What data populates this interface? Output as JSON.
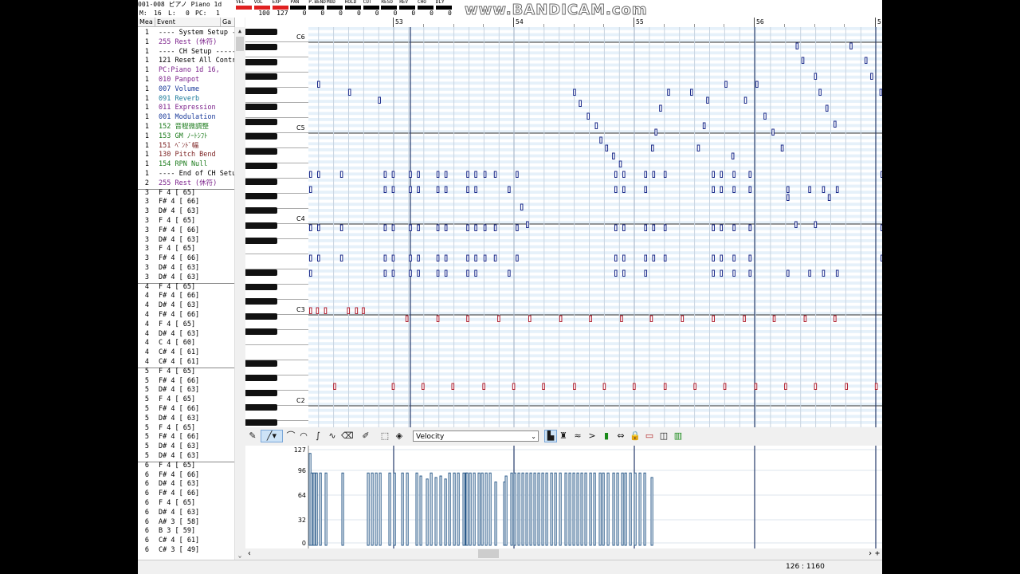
{
  "header": {
    "track_name": "001-008 ピアノ Piano 1d",
    "m_label": "M:",
    "m_value": "16",
    "l_label": "L:",
    "l_value": "0",
    "pc_label": "PC:",
    "pc_value": "1",
    "meters": [
      {
        "label": "VEL",
        "value": "",
        "color": "#e02020"
      },
      {
        "label": "VOL",
        "value": "100",
        "color": "#e02020"
      },
      {
        "label": "EXP",
        "value": "127",
        "color": "#e02020"
      },
      {
        "label": "PAN",
        "value": "0",
        "color": "#000000"
      },
      {
        "label": "P.BEND",
        "value": "0",
        "color": "#000000"
      },
      {
        "label": "MOD",
        "value": "0",
        "color": "#000000"
      },
      {
        "label": "HOLD",
        "value": "0",
        "color": "#000000"
      },
      {
        "label": "CUT",
        "value": "0",
        "color": "#000000"
      },
      {
        "label": "RESO",
        "value": "0",
        "color": "#000000"
      },
      {
        "label": "REV",
        "value": "0",
        "color": "#000000"
      },
      {
        "label": "CHO",
        "value": "0",
        "color": "#000000"
      },
      {
        "label": "DLY",
        "value": "0",
        "color": "#000000"
      }
    ],
    "watermark": "www.BANDICAM.com"
  },
  "event_list": {
    "col_meas": "Mea",
    "col_event": "Event",
    "col_gate": "Ga",
    "rows": [
      {
        "meas": "1",
        "text": "---- System Setup -",
        "color": "#000000"
      },
      {
        "meas": "1",
        "text": "255 Rest (休符)",
        "color": "#7a1f8a"
      },
      {
        "meas": "1",
        "text": "---- CH Setup -----",
        "color": "#000000"
      },
      {
        "meas": "1",
        "text": "121 Reset All Contr",
        "color": "#000000"
      },
      {
        "meas": "1",
        "text": "PC:Piano 1d      16,",
        "color": "#7a1f8a",
        "box": true
      },
      {
        "meas": "1",
        "text": "010 Panpot",
        "color": "#7a1f8a"
      },
      {
        "meas": "1",
        "text": "007 Volume",
        "color": "#1a3a9a"
      },
      {
        "meas": "1",
        "text": "091 Reverb",
        "color": "#1a7a9a"
      },
      {
        "meas": "1",
        "text": "011 Expression",
        "color": "#7a1f8a"
      },
      {
        "meas": "1",
        "text": "001 Modulation",
        "color": "#1a3a9a"
      },
      {
        "meas": "1",
        "text": "152 音程微調整",
        "color": "#1a7a1a"
      },
      {
        "meas": "1",
        "text": "153 GM ﾉｰﾄｼﾌﾄ",
        "color": "#1a7a1a"
      },
      {
        "meas": "1",
        "text": "151 ﾍﾞﾝﾄﾞ幅",
        "color": "#7a1f1f"
      },
      {
        "meas": "1",
        "text": "130 Pitch Bend",
        "color": "#7a1f1f"
      },
      {
        "meas": "1",
        "text": "154 RPN Null",
        "color": "#1a7a1a"
      },
      {
        "meas": "1",
        "text": "---- End of CH Setu",
        "color": "#000000"
      },
      {
        "meas": "2",
        "text": "255 Rest (休符)",
        "color": "#7a1f8a",
        "sep": true
      },
      {
        "meas": "3",
        "text": "F  4 [ 65]",
        "color": "#000000"
      },
      {
        "meas": "3",
        "text": "F# 4 [ 66]",
        "color": "#000000"
      },
      {
        "meas": "3",
        "text": "D# 4 [ 63]",
        "color": "#000000"
      },
      {
        "meas": "3",
        "text": "F  4 [ 65]",
        "color": "#000000"
      },
      {
        "meas": "3",
        "text": "F# 4 [ 66]",
        "color": "#000000"
      },
      {
        "meas": "3",
        "text": "D# 4 [ 63]",
        "color": "#000000"
      },
      {
        "meas": "3",
        "text": "F  4 [ 65]",
        "color": "#000000"
      },
      {
        "meas": "3",
        "text": "F# 4 [ 66]",
        "color": "#000000"
      },
      {
        "meas": "3",
        "text": "D# 4 [ 63]",
        "color": "#000000"
      },
      {
        "meas": "3",
        "text": "D# 4 [ 63]",
        "color": "#000000",
        "sep": true
      },
      {
        "meas": "4",
        "text": "F  4 [ 65]",
        "color": "#000000"
      },
      {
        "meas": "4",
        "text": "F# 4 [ 66]",
        "color": "#000000"
      },
      {
        "meas": "4",
        "text": "D# 4 [ 63]",
        "color": "#000000"
      },
      {
        "meas": "4",
        "text": "F# 4 [ 66]",
        "color": "#000000"
      },
      {
        "meas": "4",
        "text": "F  4 [ 65]",
        "color": "#000000"
      },
      {
        "meas": "4",
        "text": "D# 4 [ 63]",
        "color": "#000000"
      },
      {
        "meas": "4",
        "text": "C  4 [ 60]",
        "color": "#000000"
      },
      {
        "meas": "4",
        "text": "C# 4 [ 61]",
        "color": "#000000"
      },
      {
        "meas": "4",
        "text": "C# 4 [ 61]",
        "color": "#000000",
        "sep": true
      },
      {
        "meas": "5",
        "text": "F  4 [ 65]",
        "color": "#000000"
      },
      {
        "meas": "5",
        "text": "F# 4 [ 66]",
        "color": "#000000"
      },
      {
        "meas": "5",
        "text": "D# 4 [ 63]",
        "color": "#000000"
      },
      {
        "meas": "5",
        "text": "F  4 [ 65]",
        "color": "#000000"
      },
      {
        "meas": "5",
        "text": "F# 4 [ 66]",
        "color": "#000000"
      },
      {
        "meas": "5",
        "text": "D# 4 [ 63]",
        "color": "#000000"
      },
      {
        "meas": "5",
        "text": "F  4 [ 65]",
        "color": "#000000"
      },
      {
        "meas": "5",
        "text": "F# 4 [ 66]",
        "color": "#000000"
      },
      {
        "meas": "5",
        "text": "D# 4 [ 63]",
        "color": "#000000"
      },
      {
        "meas": "5",
        "text": "D# 4 [ 63]",
        "color": "#000000",
        "sep": true
      },
      {
        "meas": "6",
        "text": "F  4 [ 65]",
        "color": "#000000"
      },
      {
        "meas": "6",
        "text": "F# 4 [ 66]",
        "color": "#000000"
      },
      {
        "meas": "6",
        "text": "D# 4 [ 63]",
        "color": "#000000"
      },
      {
        "meas": "6",
        "text": "F# 4 [ 66]",
        "color": "#000000"
      },
      {
        "meas": "6",
        "text": "F  4 [ 65]",
        "color": "#000000"
      },
      {
        "meas": "6",
        "text": "D# 4 [ 63]",
        "color": "#000000"
      },
      {
        "meas": "6",
        "text": "A# 3 [ 58]",
        "color": "#000000"
      },
      {
        "meas": "6",
        "text": "B  3 [ 59]",
        "color": "#000000"
      },
      {
        "meas": "6",
        "text": "C# 4 [ 61]",
        "color": "#000000"
      },
      {
        "meas": "6",
        "text": "C# 3 [ 49]",
        "color": "#000000"
      }
    ]
  },
  "ruler": {
    "measures": [
      "53",
      "54",
      "55",
      "56",
      "5"
    ]
  },
  "keyboard": {
    "octave_labels": [
      "C6",
      "C5",
      "C4",
      "C3",
      "C2"
    ]
  },
  "notes": {
    "row_a": [
      0.2,
      1.6,
      5.6,
      13.2,
      14.6,
      17.6,
      19.0,
      22.4,
      23.8,
      27.6,
      29.0,
      30.6,
      32.4,
      36.2,
      53.4,
      54.8,
      58.6,
      60.0,
      62.0,
      70.4,
      71.8,
      74.0,
      76.8,
      99.8
    ],
    "row_b": [
      0.2,
      13.2,
      14.6,
      17.6,
      19.0,
      22.4,
      23.8,
      27.6,
      29.0,
      34.8,
      53.4,
      54.8,
      58.6,
      70.4,
      71.8,
      74.0,
      76.8,
      83.4,
      87.2,
      89.6,
      92.0
    ],
    "red_row_1": [
      0.2,
      1.4,
      2.8,
      6.8,
      8.2,
      9.4
    ],
    "red_row_2": [
      17.0,
      22.4,
      27.6,
      33.0,
      38.4,
      43.8,
      49.0,
      54.4,
      59.6,
      65.0,
      70.4,
      75.8,
      81.0,
      86.4,
      91.6
    ],
    "red_row_3": [
      4.4,
      14.6,
      19.8,
      25.0,
      30.4,
      35.6,
      40.8,
      46.2,
      51.4,
      56.6,
      62.0,
      67.2,
      72.4,
      77.8,
      83.0,
      88.2,
      93.6,
      98.8
    ],
    "scatter": [
      [
        1.6,
        68
      ],
      [
        7.0,
        78
      ],
      [
        12.2,
        88
      ],
      [
        46.2,
        78
      ],
      [
        47.2,
        92
      ],
      [
        48.6,
        108
      ],
      [
        50.0,
        120
      ],
      [
        50.8,
        138
      ],
      [
        51.8,
        148
      ],
      [
        53.0,
        158
      ],
      [
        54.2,
        168
      ],
      [
        59.8,
        148
      ],
      [
        60.4,
        128
      ],
      [
        61.2,
        98
      ],
      [
        62.6,
        78
      ],
      [
        66.6,
        78
      ],
      [
        67.8,
        148
      ],
      [
        68.8,
        120
      ],
      [
        69.4,
        88
      ],
      [
        72.6,
        68
      ],
      [
        73.8,
        158
      ],
      [
        76.0,
        88
      ],
      [
        78.0,
        68
      ],
      [
        79.4,
        108
      ],
      [
        80.8,
        128
      ],
      [
        82.4,
        148
      ],
      [
        85.0,
        20
      ],
      [
        86.0,
        38
      ],
      [
        88.2,
        58
      ],
      [
        89.0,
        78
      ],
      [
        90.2,
        98
      ],
      [
        91.6,
        118
      ],
      [
        94.4,
        20
      ],
      [
        97.0,
        38
      ],
      [
        98.0,
        58
      ],
      [
        99.6,
        78
      ],
      [
        83.4,
        210
      ],
      [
        84.8,
        244
      ],
      [
        88.2,
        244
      ],
      [
        90.6,
        210
      ],
      [
        37.0,
        222
      ],
      [
        38.0,
        244
      ]
    ]
  },
  "toolbar": {
    "controller_select": "Velocity"
  },
  "velocity": {
    "axis_labels": [
      "127",
      "96",
      "64",
      "32",
      "0"
    ],
    "values": [
      122,
      96,
      96,
      96,
      96,
      96,
      96,
      96,
      96,
      96,
      96,
      96,
      96,
      96,
      96,
      96,
      92,
      88,
      96,
      90,
      92,
      88,
      96,
      96,
      96,
      96,
      96,
      96,
      96,
      96,
      96,
      96,
      96,
      96,
      84,
      84,
      92,
      96,
      96,
      96,
      96,
      96,
      96,
      96,
      96,
      96,
      96,
      96,
      96,
      96,
      96,
      96,
      96,
      96,
      96,
      96,
      96,
      96,
      96,
      96,
      96,
      96,
      96,
      96,
      96,
      96,
      96,
      96,
      96,
      90
    ]
  },
  "status": {
    "position": "126 : 1160"
  }
}
